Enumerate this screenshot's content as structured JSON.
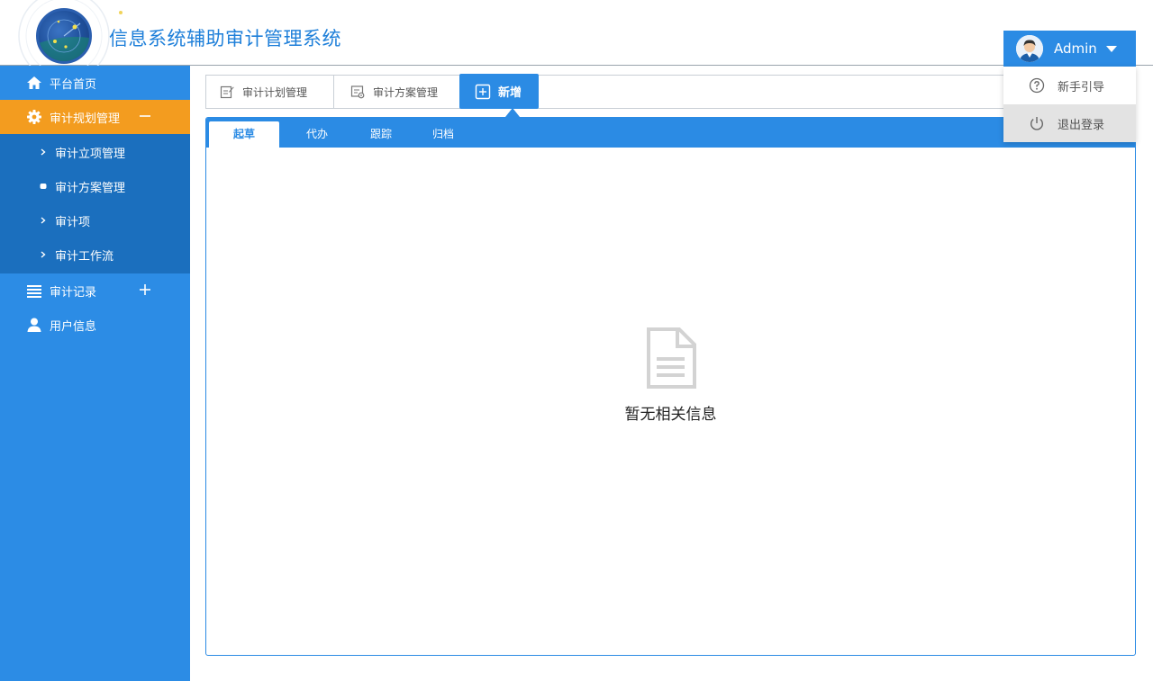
{
  "app": {
    "title": "信息系统辅助审计管理系统"
  },
  "user": {
    "name": "Admin",
    "menu": [
      {
        "label": "新手引导",
        "icon": "help-circle-icon"
      },
      {
        "label": "退出登录",
        "icon": "power-icon"
      }
    ]
  },
  "sidebar": {
    "items": [
      {
        "label": "平台首页",
        "icon": "home-icon"
      },
      {
        "label": "审计规划管理",
        "icon": "gear-icon",
        "toggle": "collapse-minus-icon"
      },
      {
        "label": "审计记录",
        "icon": "list-icon",
        "toggle": "expand-plus-icon"
      },
      {
        "label": "用户信息",
        "icon": "user-icon"
      }
    ],
    "subitems": [
      {
        "label": "审计立项管理",
        "icon": "chevron-right-icon"
      },
      {
        "label": "审计方案管理",
        "icon": "bullet-icon"
      },
      {
        "label": "审计项",
        "icon": "chevron-right-icon"
      },
      {
        "label": "审计工作流",
        "icon": "chevron-right-icon"
      }
    ]
  },
  "toolbar": {
    "buttons": [
      {
        "label": "审计计划管理",
        "icon": "edit-doc-icon"
      },
      {
        "label": "审计方案管理",
        "icon": "doc-settings-icon"
      }
    ],
    "add_label": "新增"
  },
  "tabs": [
    "起草",
    "代办",
    "跟踪",
    "归档"
  ],
  "empty": {
    "text": "暂无相关信息",
    "icon": "document-icon"
  },
  "colors": {
    "primary": "#2b8be4",
    "active": "#f39c1f",
    "submenu": "#1b6fbe"
  }
}
